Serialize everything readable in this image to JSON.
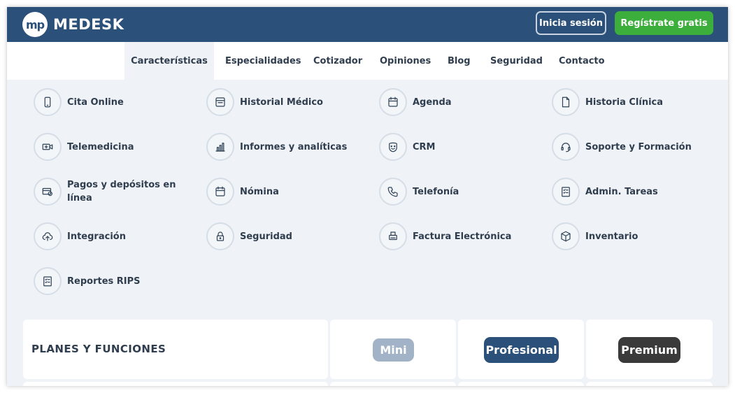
{
  "header": {
    "logo_mark": "mp",
    "brand": "MEDESK",
    "login_label": "Inicia sesión",
    "register_label": "Regístrate gratis",
    "colors": {
      "bar": "#2b5079",
      "register": "#3cae3c"
    }
  },
  "nav": {
    "items": [
      {
        "label": "Características"
      },
      {
        "label": "Especialidades"
      },
      {
        "label": "Cotizador"
      },
      {
        "label": "Opiniones"
      },
      {
        "label": "Blog"
      },
      {
        "label": "Seguridad"
      },
      {
        "label": "Contacto"
      }
    ]
  },
  "features": [
    {
      "label": "Cita Online",
      "icon": "phone-icon"
    },
    {
      "label": "Historial Médico",
      "icon": "record-icon"
    },
    {
      "label": "Agenda",
      "icon": "calendar-icon"
    },
    {
      "label": "Historia Clínica",
      "icon": "document-icon"
    },
    {
      "label": "Telemedicina",
      "icon": "video-icon"
    },
    {
      "label": "Informes y analíticas",
      "icon": "bar-chart-icon"
    },
    {
      "label": "CRM",
      "icon": "smiley-icon"
    },
    {
      "label": "Soporte y Formación",
      "icon": "headset-icon"
    },
    {
      "label": "Pagos y depósitos en línea",
      "icon": "payment-icon"
    },
    {
      "label": "Nómina",
      "icon": "calendar-icon"
    },
    {
      "label": "Telefonía",
      "icon": "telephone-icon"
    },
    {
      "label": "Admin. Tareas",
      "icon": "checklist-icon"
    },
    {
      "label": "Integración",
      "icon": "cloud-upload-icon"
    },
    {
      "label": "Seguridad",
      "icon": "lock-icon"
    },
    {
      "label": "Factura Electrónica",
      "icon": "printer-icon"
    },
    {
      "label": "Inventario",
      "icon": "box-icon"
    },
    {
      "label": "Reportes RIPS",
      "icon": "checklist-icon"
    }
  ],
  "plans": {
    "title": "PLANES Y FUNCIONES",
    "tiers": [
      {
        "label": "Mini",
        "color": "#a3b3c7"
      },
      {
        "label": "Profesional",
        "color": "#2b5079"
      },
      {
        "label": "Premium",
        "color": "#3a3a3a"
      }
    ]
  }
}
